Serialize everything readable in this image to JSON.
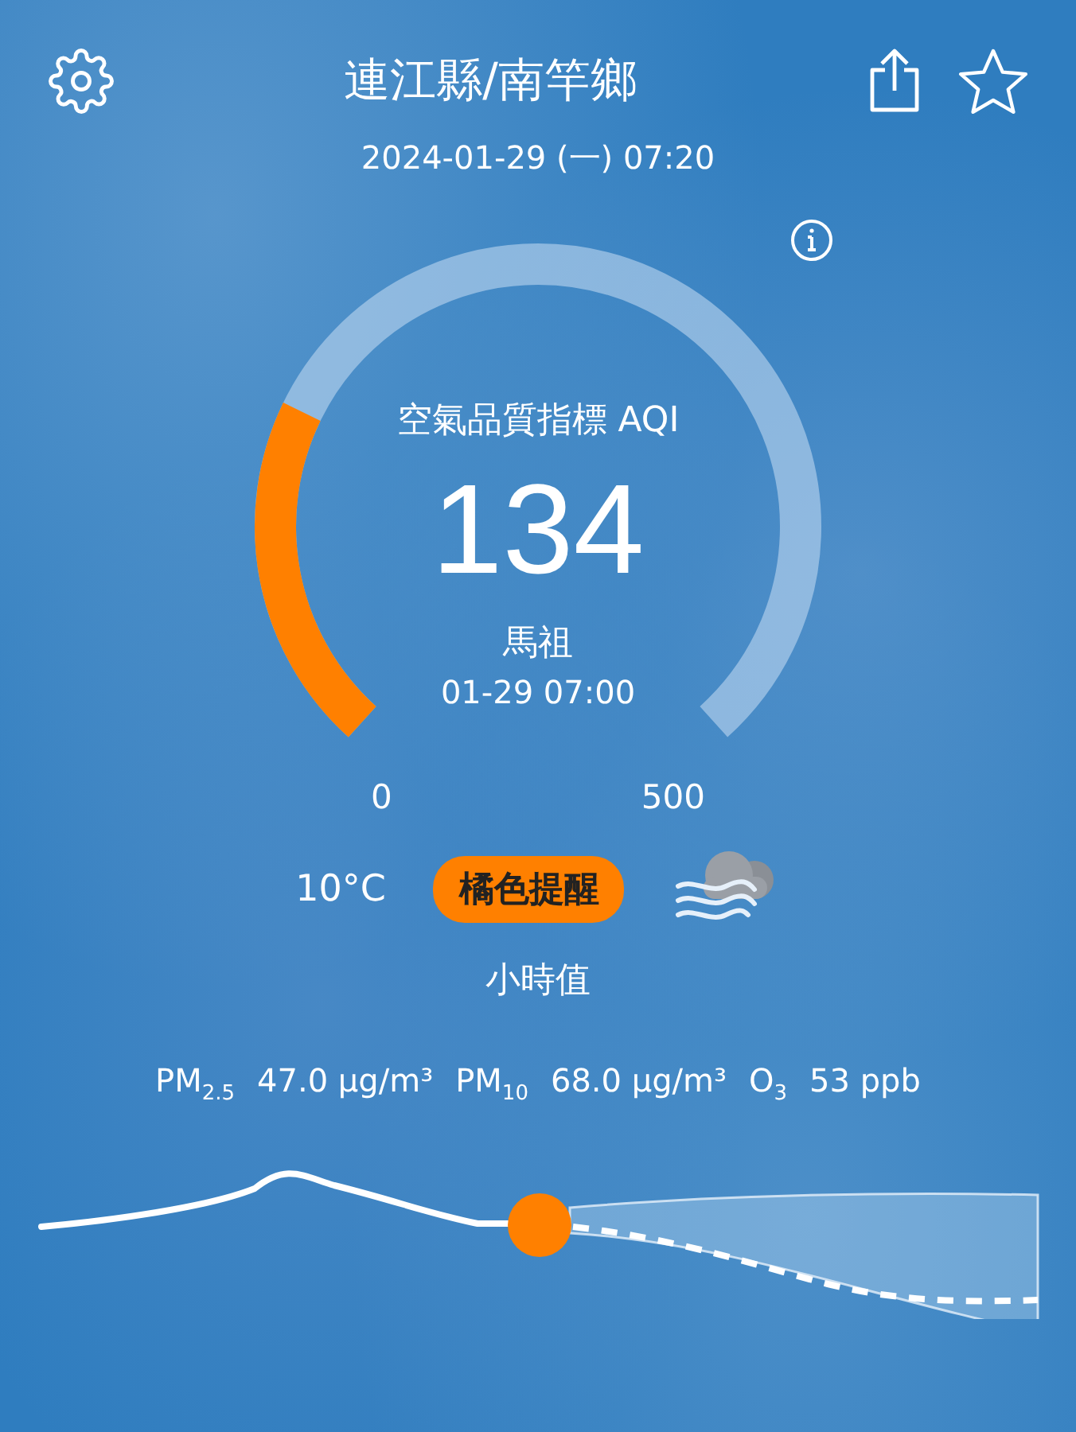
{
  "header": {
    "title": "連江縣/南竿鄉",
    "datetime": "2024-01-29 (一) 07:20"
  },
  "aqi": {
    "label": "空氣品質指標 AQI",
    "value": "134",
    "station": "馬祖",
    "time": "01-29 07:00",
    "min": "0",
    "max": "500"
  },
  "conditions": {
    "temperature": "10°C",
    "alert": "橘色提醒",
    "period": "小時值"
  },
  "pollutants": [
    {
      "label": "PM$_{2.5}$",
      "value": "47.0 µg/m³"
    },
    {
      "label": "PM$_{10}$",
      "value": "68.0 µg/m³"
    },
    {
      "label": "O$_{3}$",
      "value": "53 ppb"
    }
  ]
}
